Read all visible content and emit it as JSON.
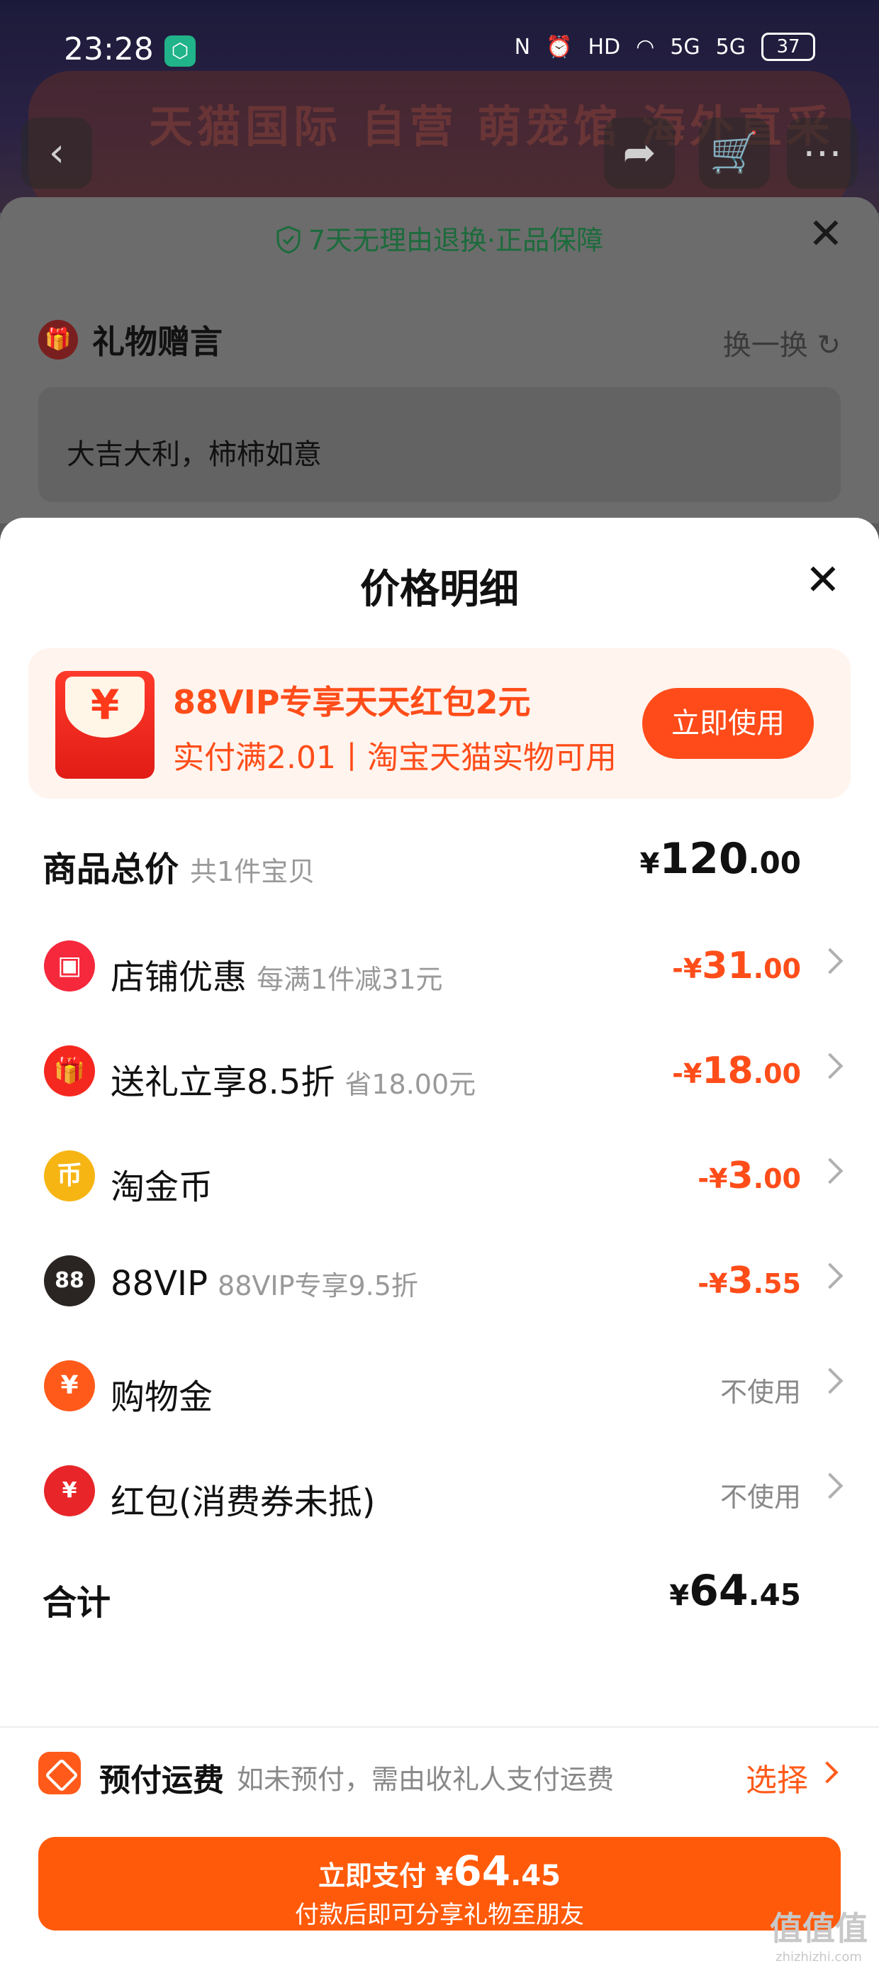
{
  "status_bar": {
    "time": "23:28",
    "network": "5G",
    "battery": "37"
  },
  "background": {
    "banner_text": "天猫国际 自营 萌宠馆 海外直采"
  },
  "gift_sheet": {
    "guarantee": "7天无理由退换·正品保障",
    "title": "礼物赠言",
    "swap_label": "换一换",
    "message": "大吉大利，柿柿如意"
  },
  "price_sheet": {
    "title": "价格明细",
    "promo": {
      "title": "88VIP专享天天红包2元",
      "subtitle": "实付满2.01丨淘宝天猫实物可用",
      "button": "立即使用",
      "envelope_symbol": "¥"
    },
    "subtotal": {
      "label": "商品总价",
      "sub": "共1件宝贝",
      "currency": "¥",
      "int": "120",
      "dec": ".00"
    },
    "rows": [
      {
        "label": "店铺优惠",
        "hint": "每满1件减31元",
        "amount_prefix": "-¥",
        "amount_int": "31",
        "amount_dec": ".00",
        "icon": "shop-icon",
        "color": "#f5283c"
      },
      {
        "label": "送礼立享8.5折",
        "hint": "省18.00元",
        "amount_prefix": "-¥",
        "amount_int": "18",
        "amount_dec": ".00",
        "icon": "gift-icon",
        "color": "#f52820"
      },
      {
        "label": "淘金币",
        "hint": "",
        "amount_prefix": "-¥",
        "amount_int": "3",
        "amount_dec": ".00",
        "icon": "coin-icon",
        "color": "#f7b514"
      },
      {
        "label": "88VIP",
        "hint": "88VIP专享9.5折",
        "amount_prefix": "-¥",
        "amount_int": "3",
        "amount_dec": ".55",
        "icon": "vip-icon",
        "color": "#2a2522"
      },
      {
        "label": "购物金",
        "hint": "",
        "status": "不使用",
        "icon": "money-bag-icon",
        "color": "#ff5a1a"
      },
      {
        "label": "红包(消费券未抵)",
        "hint": "",
        "status": "不使用",
        "icon": "red-packet-icon",
        "color": "#e8262a"
      }
    ],
    "total": {
      "label": "合计",
      "currency": "¥",
      "int": "64",
      "dec": ".45"
    },
    "freight": {
      "title": "预付运费",
      "desc": "如未预付，需由收礼人支付运费",
      "select": "选择"
    },
    "pay": {
      "label": "立即支付",
      "currency": "¥",
      "int": "64",
      "dec": ".45",
      "sub": "付款后即可分享礼物至朋友"
    }
  },
  "watermark": {
    "main": "值值值",
    "sub": "zhizhizhi.com"
  },
  "colors": {
    "accent": "#ff5a0a",
    "discount": "#ff4d1a",
    "guarantee": "#1c6b3c"
  }
}
